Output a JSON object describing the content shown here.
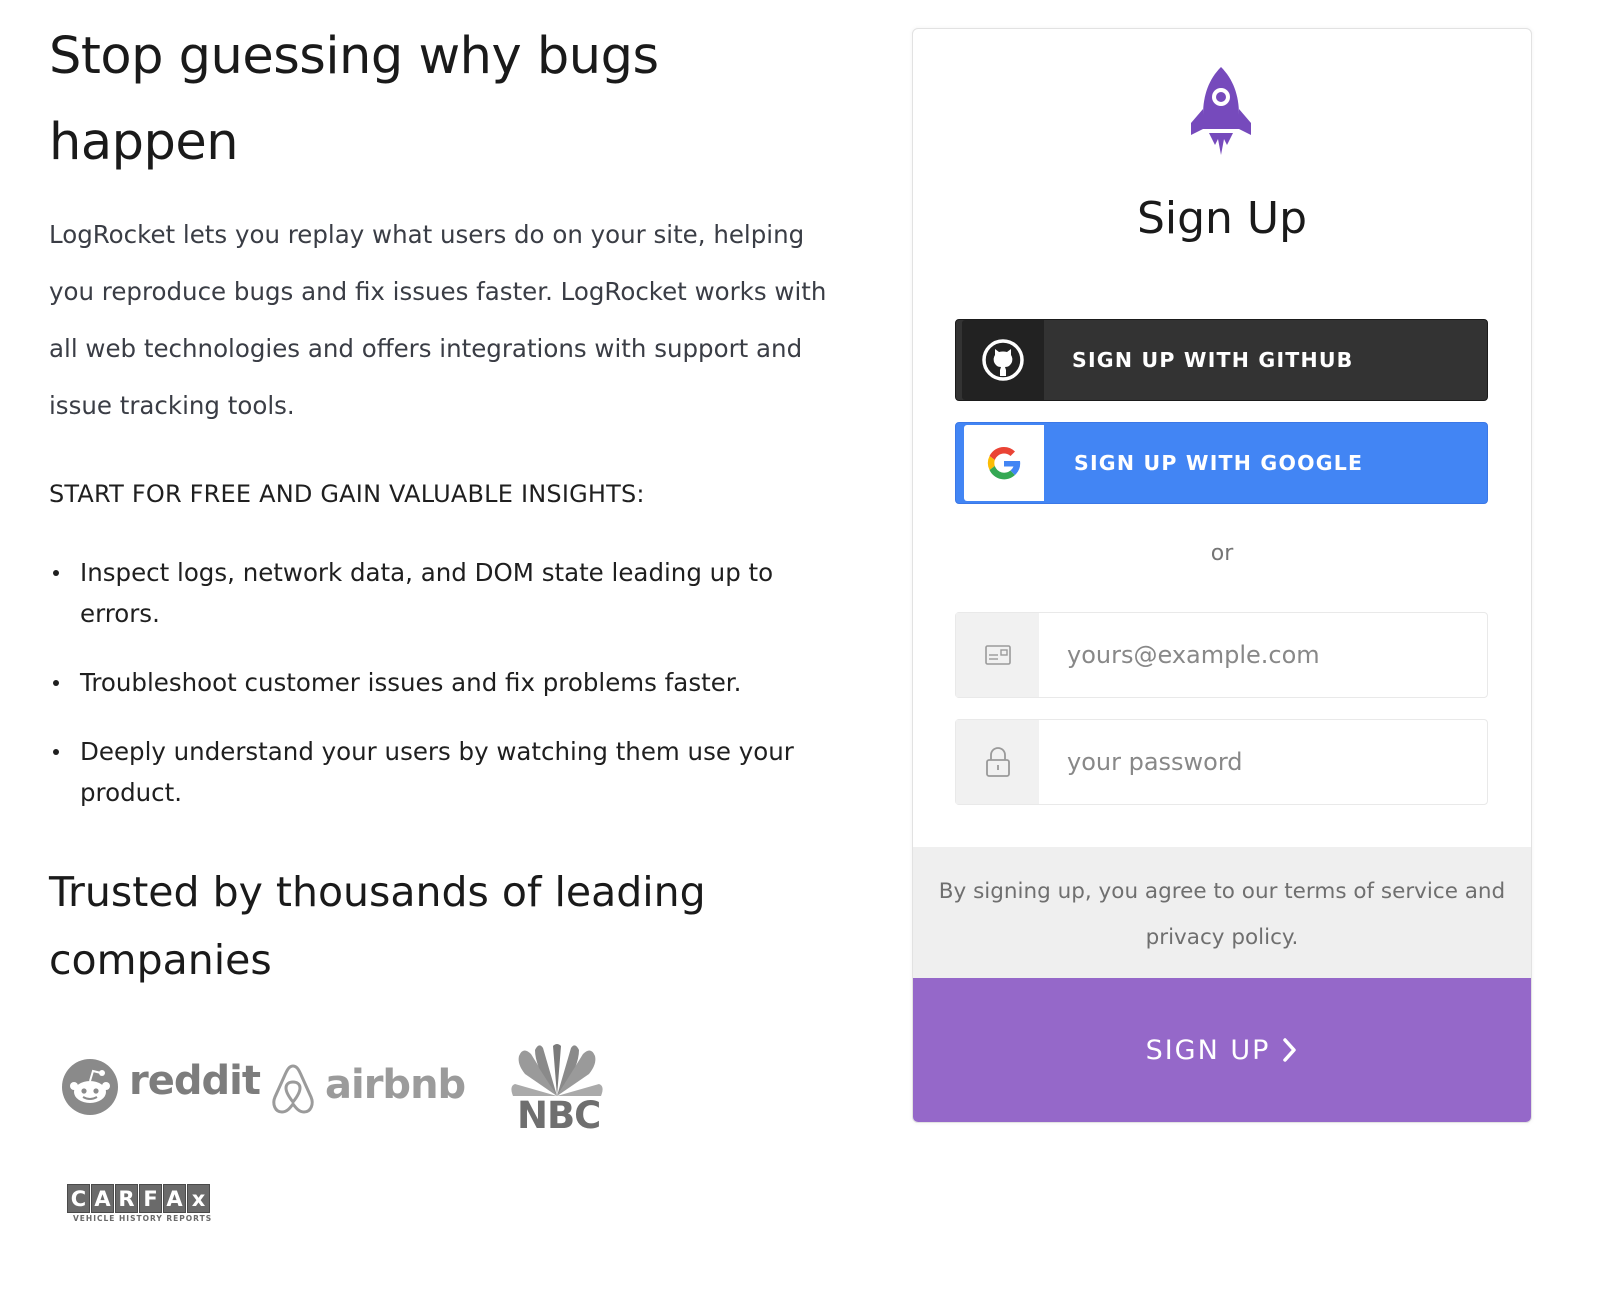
{
  "hero": {
    "title": "Stop guessing why bugs happen",
    "description": "LogRocket lets you replay what users do on your site, helping you reproduce bugs and fix issues faster. LogRocket works with all web technologies and offers integrations with support and issue tracking tools."
  },
  "insights": {
    "heading": "START FOR FREE AND GAIN VALUABLE INSIGHTS:",
    "items": [
      "Inspect logs, network data, and DOM state leading up to errors.",
      "Troubleshoot customer issues and fix problems faster.",
      "Deeply understand your users by watching them use your product."
    ]
  },
  "trusted": {
    "title": "Trusted by thousands of leading companies",
    "logos": {
      "reddit": "reddit",
      "airbnb": "airbnb",
      "nbc": "NBC",
      "carfax_letters": [
        "C",
        "A",
        "R",
        "F",
        "A",
        "x"
      ],
      "carfax_sub": "VEHICLE HISTORY REPORTS"
    }
  },
  "signup": {
    "title": "Sign Up",
    "github_label": "SIGN UP WITH GITHUB",
    "google_label": "SIGN UP WITH GOOGLE",
    "or_text": "or",
    "email_placeholder": "yours@example.com",
    "password_placeholder": "your password",
    "terms_text": "By signing up, you agree to our terms of service and privacy policy.",
    "submit_label": "SIGN UP"
  },
  "colors": {
    "brand_purple": "#764abc",
    "submit_purple": "#9568c9",
    "github_dark": "#333333",
    "google_blue": "#4285f4"
  },
  "icons": {
    "logo": "rocket-icon",
    "github": "github-icon",
    "google": "google-icon",
    "email": "envelope-icon",
    "password": "lock-icon",
    "submit": "chevron-right-icon"
  }
}
